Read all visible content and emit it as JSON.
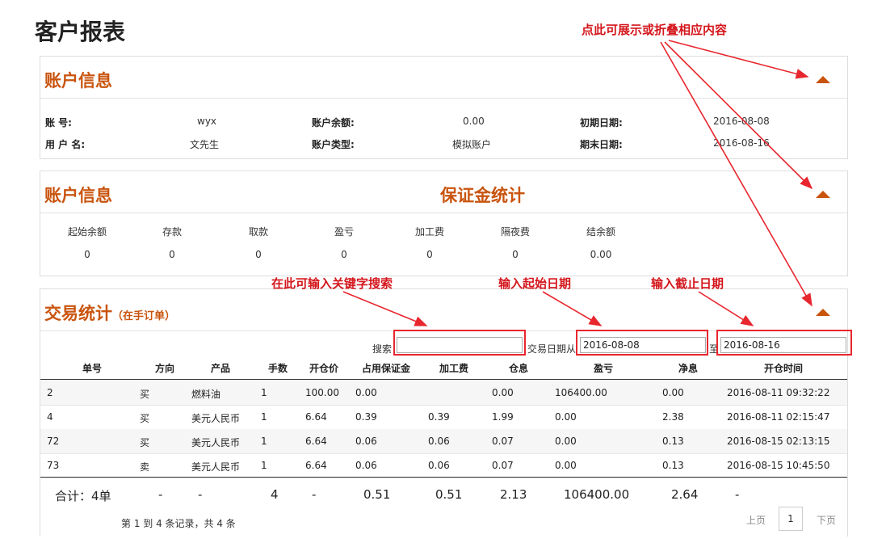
{
  "page_title": "客户报表",
  "annotations": {
    "toggle_hint": "点此可展示或折叠相应内容",
    "search_hint": "在此可输入关键字搜索",
    "start_hint": "输入起始日期",
    "end_hint": "输入截止日期"
  },
  "account_info": {
    "title": "账户信息",
    "labels": {
      "account_no": "账 号:",
      "username": "用 户 名:",
      "balance": "账户余额:",
      "account_type": "账户类型:",
      "start_date": "初期日期:",
      "end_date": "期末日期:"
    },
    "values": {
      "account_no": "wyx",
      "username": "文先生",
      "balance": "0.00",
      "account_type": "模拟账户",
      "start_date": "2016-08-08",
      "end_date": "2016-08-16"
    }
  },
  "margin_stats": {
    "title": "账户信息",
    "subtitle": "保证金统计",
    "headers": [
      "起始余额",
      "存款",
      "取款",
      "盈亏",
      "加工费",
      "隔夜费",
      "结余额"
    ],
    "values": [
      "0",
      "0",
      "0",
      "0",
      "0",
      "0",
      "0.00"
    ]
  },
  "trades": {
    "title": "交易统计",
    "title_note": "（在手订单）",
    "search_label": "搜索",
    "search_value": "",
    "date_label": "交易日期从",
    "date_from": "2016-08-08",
    "date_to_label": "至",
    "date_to": "2016-08-16",
    "columns": [
      "单号",
      "方向",
      "产品",
      "手数",
      "开仓价",
      "占用保证金",
      "加工费",
      "仓息",
      "盈亏",
      "净息",
      "开仓时间"
    ],
    "rows": [
      [
        "2",
        "买",
        "燃料油",
        "1",
        "100.00",
        "0.00",
        "",
        "0.00",
        "106400.00",
        "0.00",
        "2016-08-11 09:32:22"
      ],
      [
        "4",
        "买",
        "美元人民币",
        "1",
        "6.64",
        "0.39",
        "0.39",
        "1.99",
        "0.00",
        "2.38",
        "2016-08-11 02:15:47"
      ],
      [
        "72",
        "买",
        "美元人民币",
        "1",
        "6.64",
        "0.06",
        "0.06",
        "0.07",
        "0.00",
        "0.13",
        "2016-08-15 02:13:15"
      ],
      [
        "73",
        "卖",
        "美元人民币",
        "1",
        "6.64",
        "0.06",
        "0.06",
        "0.07",
        "0.00",
        "0.13",
        "2016-08-15 10:45:50"
      ]
    ],
    "totals": [
      "合计：4单",
      "-",
      "-",
      "4",
      "-",
      "0.51",
      "0.51",
      "2.13",
      "106400.00",
      "2.64",
      "-"
    ],
    "records_text": "第 1 到 4 条记录，共 4 条",
    "pager": {
      "prev": "上页",
      "current": "1",
      "next": "下页"
    }
  },
  "colors": {
    "accent": "#c9540e",
    "annotation": "#d4161c"
  }
}
